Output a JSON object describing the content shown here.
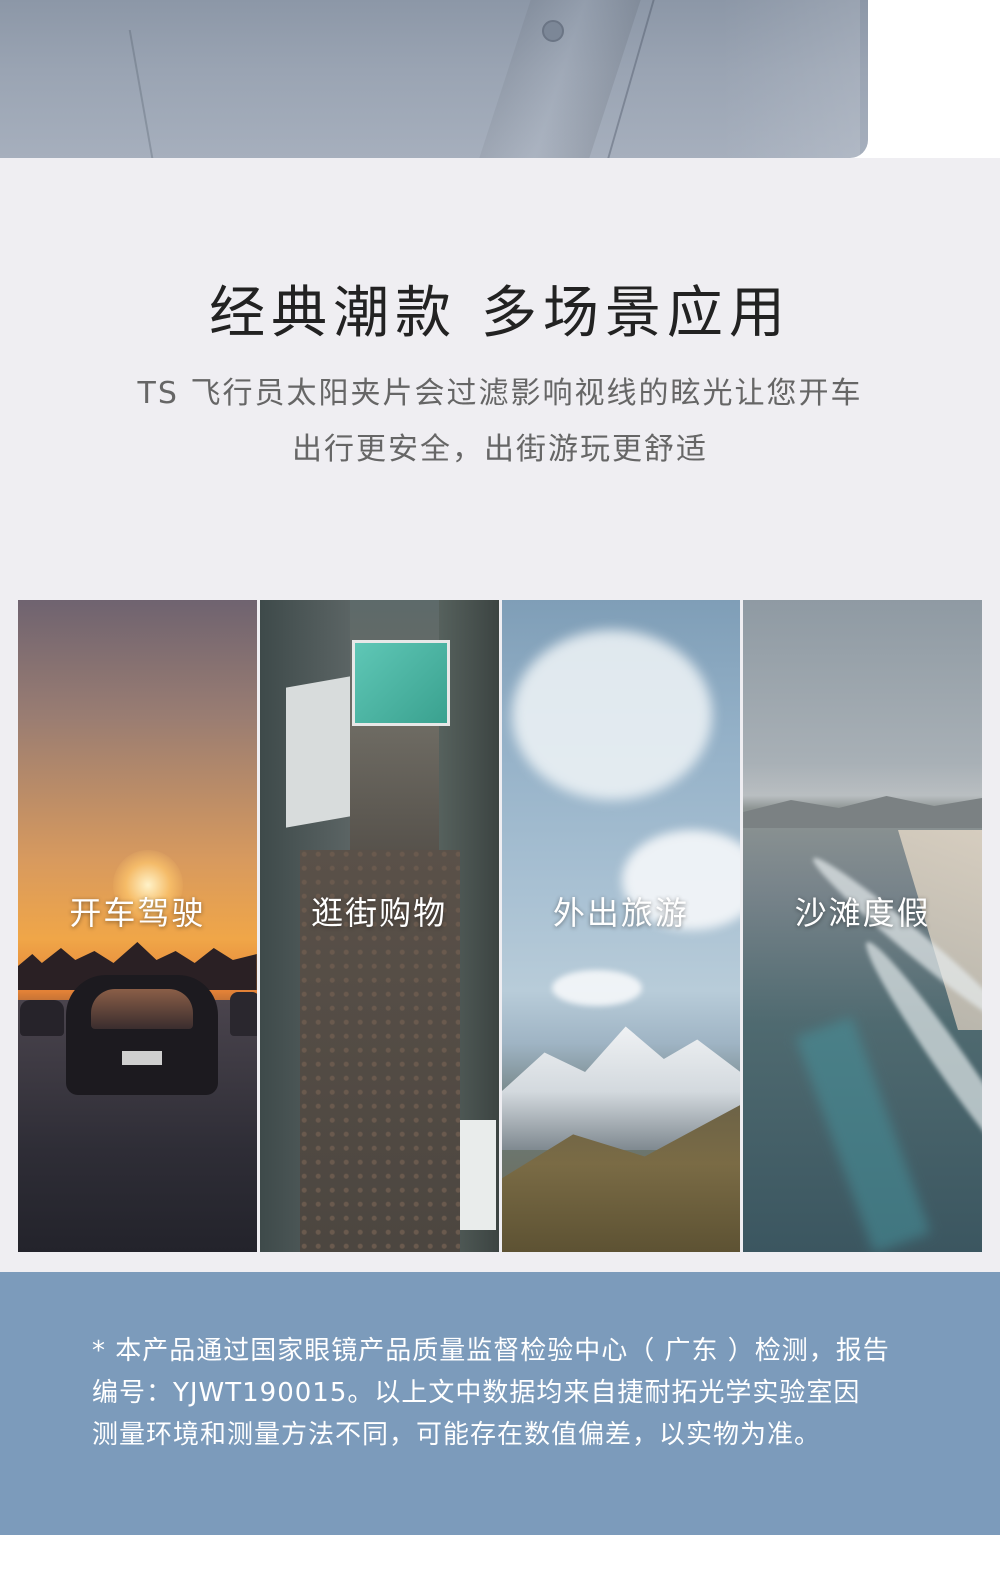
{
  "headline": "经典潮款  多场景应用",
  "description": {
    "line1": "TS 飞行员太阳夹片会过滤影响视线的眩光让您开车",
    "line2": "出行更安全，出街游玩更舒适"
  },
  "scenes": [
    {
      "label": "开车驾驶",
      "icon": "driving-scene"
    },
    {
      "label": "逛街购物",
      "icon": "shopping-scene"
    },
    {
      "label": "外出旅游",
      "icon": "travel-scene"
    },
    {
      "label": "沙滩度假",
      "icon": "beach-scene"
    }
  ],
  "notice": {
    "line1": "* 本产品通过国家眼镜产品质量监督检验中心（ 广东 ）检测，报告",
    "line2": "编号：YJWT190015。以上文中数据均来自捷耐拓光学实验室因",
    "line3": "测量环境和测量方法不同，可能存在数值偏差，以实物为准。"
  },
  "colors": {
    "section_bg": "#efeef2",
    "notice_bg": "#7c9bbb",
    "headline": "#222222",
    "description": "#666666"
  }
}
